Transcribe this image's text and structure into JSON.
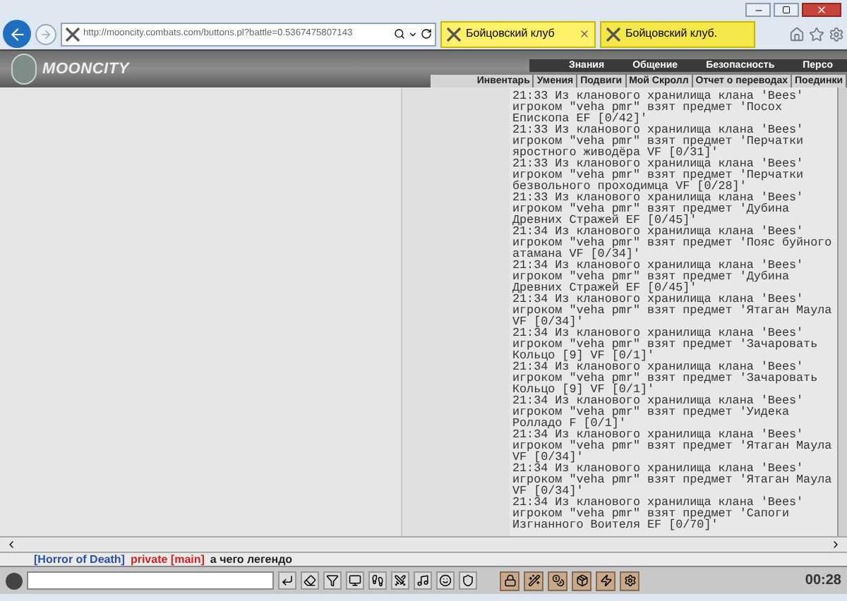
{
  "browser": {
    "address": "http://mooncity.combats.com/buttons.pl?battle=0.5367475807143",
    "tabs": [
      {
        "title": "Бойцовский клуб",
        "selected": true
      },
      {
        "title": "Бойцовский клуб.",
        "selected": false
      }
    ]
  },
  "header": {
    "logo": "MOONCITY",
    "top_menu": [
      "Знания",
      "Общение",
      "Безопасность",
      "Персо"
    ],
    "sub_menu": [
      "Инвентарь",
      "Умения",
      "Подвиги",
      "Мой Скролл",
      "Отчет о переводах",
      "Поединки"
    ]
  },
  "log": [
    "21:33 Из кланового хранилища клана 'Bees' игроком \"veha pmr\" взят предмет 'Посох Епископа EF [0/42]'",
    "21:33 Из кланового хранилища клана 'Bees' игроком \"veha pmr\" взят предмет 'Перчатки яростного живодёра VF [0/31]'",
    "21:33 Из кланового хранилища клана 'Bees' игроком \"veha pmr\" взят предмет 'Перчатки безвольного проходимца VF [0/28]'",
    "21:33 Из кланового хранилища клана 'Bees' игроком \"veha pmr\" взят предмет 'Дубина Древних Стражей EF [0/45]'",
    "21:34 Из кланового хранилища клана 'Bees' игроком \"veha pmr\" взят предмет 'Пояс буйного атамана VF [0/34]'",
    "21:34 Из кланового хранилища клана 'Bees' игроком \"veha pmr\" взят предмет 'Дубина Древних Стражей EF [0/45]'",
    "21:34 Из кланового хранилища клана 'Bees' игроком \"veha pmr\" взят предмет 'Ятаган Маула VF [0/34]'",
    "21:34 Из кланового хранилища клана 'Bees' игроком \"veha pmr\" взят предмет 'Зачаровать Кольцо [9] VF [0/1]'",
    "21:34 Из кланового хранилища клана 'Bees' игроком \"veha pmr\" взят предмет 'Зачаровать Кольцо [9] VF [0/1]'",
    "21:34 Из кланового хранилища клана 'Bees' игроком \"veha pmr\" взят предмет 'Уидека Ролладо F [0/1]'",
    "21:34 Из кланового хранилища клана 'Bees' игроком \"veha pmr\" взят предмет 'Ятаган Маула VF [0/34]'",
    "21:34 Из кланового хранилища клана 'Bees' игроком \"veha pmr\" взят предмет 'Ятаган Маула VF [0/34]'",
    "21:34 Из кланового хранилища клана 'Bees' игроком \"veha pmr\" взят предмет 'Сапоги Изгнанного Воителя EF [0/70]'"
  ],
  "chat": [
    {
      "text": "[Horror of Death]",
      "color": "#2b4fa8"
    },
    {
      "text": "private [main]",
      "color": "#d42020"
    },
    {
      "text": "а чего легендо",
      "color": "#222222"
    }
  ],
  "clock": "00:28"
}
